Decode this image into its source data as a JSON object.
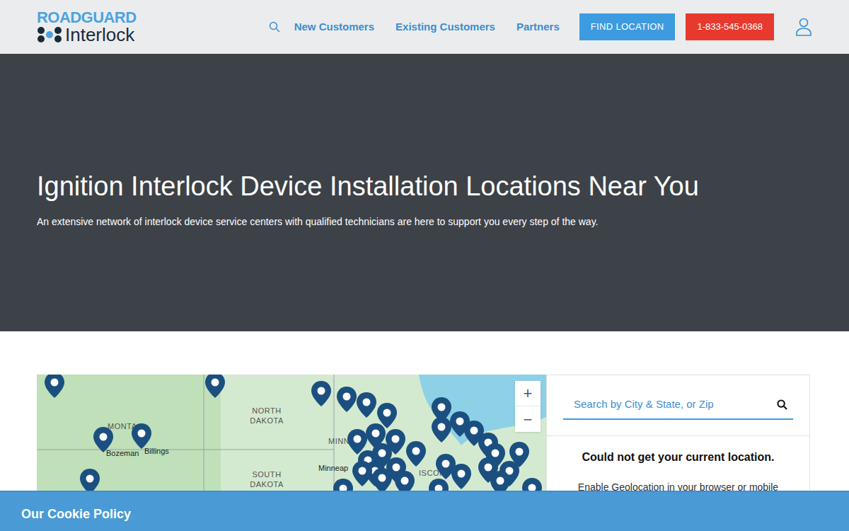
{
  "header": {
    "logo": {
      "top": "ROADGUARD",
      "bottom": "Interlock"
    },
    "nav": [
      {
        "label": "New Customers"
      },
      {
        "label": "Existing Customers"
      },
      {
        "label": "Partners"
      }
    ],
    "find_button": "FIND LOCATION",
    "phone_button": "1-833-545-0368"
  },
  "hero": {
    "title": "Ignition Interlock Device Installation Locations Near You",
    "subtitle": "An extensive network of interlock device service centers with qualified technicians are here to support you every step of the way."
  },
  "map": {
    "labels": [
      {
        "text": "NORTH DAKOTA",
        "kind": "state"
      },
      {
        "text": "SOUTH DAKOTA",
        "kind": "state"
      },
      {
        "text": "MONTA",
        "kind": "state"
      },
      {
        "text": "MINN",
        "kind": "state"
      },
      {
        "text": "ISCON",
        "kind": "state"
      },
      {
        "text": "Bozeman",
        "kind": "city"
      },
      {
        "text": "Billings",
        "kind": "city"
      },
      {
        "text": "Minneap",
        "kind": "city"
      }
    ],
    "zoom_in": "+",
    "zoom_out": "−"
  },
  "panel": {
    "search_placeholder": "Search by City & State, or Zip",
    "message": "Could not get your current location.",
    "hint": "Enable Geolocation in your browser or mobile"
  },
  "cookie": {
    "title": "Our Cookie Policy"
  }
}
